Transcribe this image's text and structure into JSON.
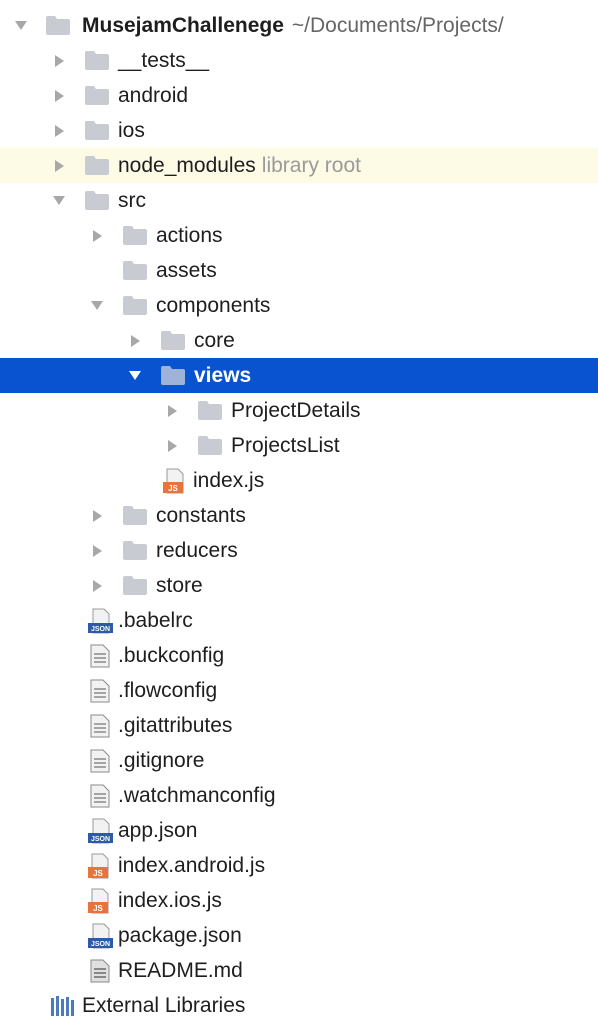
{
  "tree": {
    "root": {
      "name": "MusejamChallenege",
      "path": "~/Documents/Projects/"
    },
    "items": [
      {
        "id": "tests",
        "label": "__tests__",
        "type": "folder",
        "expanded": false
      },
      {
        "id": "android",
        "label": "android",
        "type": "folder",
        "expanded": false
      },
      {
        "id": "ios",
        "label": "ios",
        "type": "folder",
        "expanded": false
      },
      {
        "id": "node_modules",
        "label": "node_modules",
        "hint": "library root",
        "type": "folder",
        "expanded": false
      },
      {
        "id": "src",
        "label": "src",
        "type": "folder",
        "expanded": true
      },
      {
        "id": "actions",
        "label": "actions",
        "type": "folder",
        "expanded": false
      },
      {
        "id": "assets",
        "label": "assets",
        "type": "folder"
      },
      {
        "id": "components",
        "label": "components",
        "type": "folder",
        "expanded": true
      },
      {
        "id": "core",
        "label": "core",
        "type": "folder",
        "expanded": false
      },
      {
        "id": "views",
        "label": "views",
        "type": "folder",
        "expanded": true,
        "selected": true
      },
      {
        "id": "project_details",
        "label": "ProjectDetails",
        "type": "folder",
        "expanded": false
      },
      {
        "id": "projects_list",
        "label": "ProjectsList",
        "type": "folder",
        "expanded": false
      },
      {
        "id": "index_js",
        "label": "index.js",
        "type": "js"
      },
      {
        "id": "constants",
        "label": "constants",
        "type": "folder",
        "expanded": false
      },
      {
        "id": "reducers",
        "label": "reducers",
        "type": "folder",
        "expanded": false
      },
      {
        "id": "store",
        "label": "store",
        "type": "folder",
        "expanded": false
      },
      {
        "id": "babelrc",
        "label": ".babelrc",
        "type": "json"
      },
      {
        "id": "buckconfig",
        "label": ".buckconfig",
        "type": "text"
      },
      {
        "id": "flowconfig",
        "label": ".flowconfig",
        "type": "text"
      },
      {
        "id": "gitattributes",
        "label": ".gitattributes",
        "type": "text"
      },
      {
        "id": "gitignore",
        "label": ".gitignore",
        "type": "text"
      },
      {
        "id": "watchmanconfig",
        "label": ".watchmanconfig",
        "type": "text"
      },
      {
        "id": "app_json",
        "label": "app.json",
        "type": "json"
      },
      {
        "id": "index_android",
        "label": "index.android.js",
        "type": "js"
      },
      {
        "id": "index_ios",
        "label": "index.ios.js",
        "type": "js"
      },
      {
        "id": "package_json",
        "label": "package.json",
        "type": "json"
      },
      {
        "id": "readme",
        "label": "README.md",
        "type": "text"
      }
    ],
    "external": {
      "label": "External Libraries"
    }
  },
  "icons": {
    "folder": "folder-icon",
    "js": "js-file-icon",
    "json": "json-file-icon",
    "text": "text-file-icon",
    "external": "library-icon"
  },
  "colors": {
    "selection": "#0a53d0",
    "library_root_bg": "#fdfbe6",
    "folder": "#c8ccd2",
    "js_badge": "#e8743b",
    "json_badge": "#2f5aa8"
  }
}
